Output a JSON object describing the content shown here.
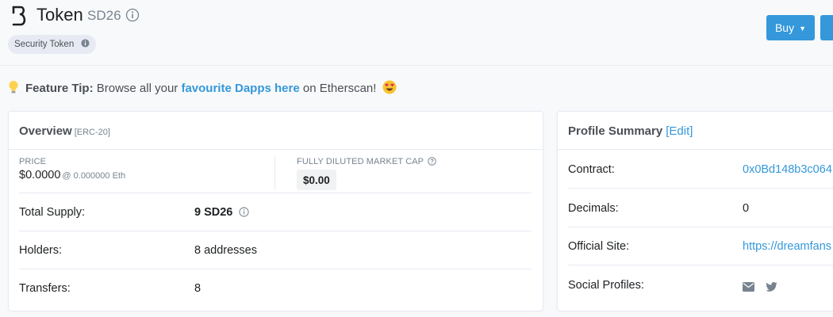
{
  "header": {
    "title": "Token",
    "symbol": "SD26",
    "badge": "Security Token",
    "buy_label": "Buy"
  },
  "tip": {
    "label": "Feature Tip:",
    "text_before": "Browse all your",
    "link": "favourite Dapps here",
    "text_after": "on Etherscan!"
  },
  "overview": {
    "title": "Overview",
    "standard": "[ERC-20]",
    "price_label": "PRICE",
    "price_value": "$0.0000",
    "price_eth": "@ 0.000000 Eth",
    "mcap_label": "FULLY DILUTED MARKET CAP",
    "mcap_value": "$0.00",
    "rows": [
      {
        "label": "Total Supply:",
        "value": "9 SD26"
      },
      {
        "label": "Holders:",
        "value": "8 addresses"
      },
      {
        "label": "Transfers:",
        "value": "8"
      }
    ]
  },
  "profile": {
    "title": "Profile Summary",
    "edit": "[Edit]",
    "rows": [
      {
        "label": "Contract:",
        "value": "0x0Bd148b3c064"
      },
      {
        "label": "Decimals:",
        "value": "0"
      },
      {
        "label": "Official Site:",
        "value": "https://dreamfans"
      },
      {
        "label": "Social Profiles:",
        "value": ""
      }
    ]
  },
  "colors": {
    "accent": "#3498db",
    "background": "#f8f9fa",
    "border": "#e7eaf3"
  },
  "icons": [
    "brand-logo-icon",
    "info-icon",
    "lightbulb-icon",
    "heart-eyes-emoji-icon",
    "question-circle-icon",
    "caret-down-icon",
    "envelope-icon",
    "twitter-icon"
  ]
}
